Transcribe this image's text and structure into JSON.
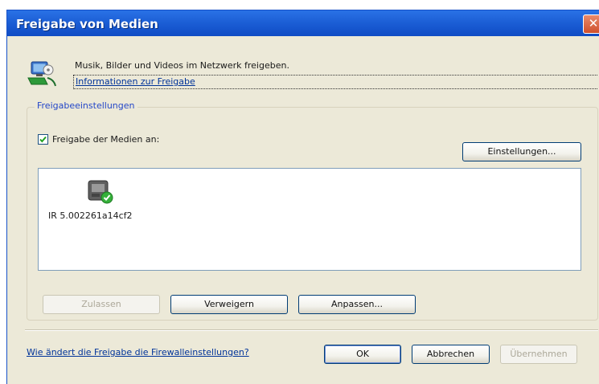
{
  "window": {
    "title": "Freigabe von Medien",
    "close_glyph": "✕"
  },
  "header": {
    "description": "Musik, Bilder und Videos im Netzwerk freigeben.",
    "info_link": "Informationen zur Freigabe",
    "icon": "media-sharing-icon"
  },
  "group": {
    "legend": "Freigabeeinstellungen",
    "share_checkbox": {
      "label": "Freigabe der Medien an:",
      "checked": true
    },
    "settings_button": "Einstellungen...",
    "devices": [
      {
        "name": "IR 5.002261a14cf2",
        "icon": "media-device-allowed-icon"
      }
    ],
    "allow_button": "Zulassen",
    "deny_button": "Verweigern",
    "customize_button": "Anpassen..."
  },
  "footer": {
    "firewall_link": "Wie ändert die Freigabe die Firewalleinstellungen?",
    "ok_button": "OK",
    "cancel_button": "Abbrechen",
    "apply_button": "Übernehmen"
  },
  "colors": {
    "title_bar": "#1c5fd6",
    "dialog_background": "#ece9d8",
    "link": "#003399",
    "legend": "#2447c8"
  }
}
